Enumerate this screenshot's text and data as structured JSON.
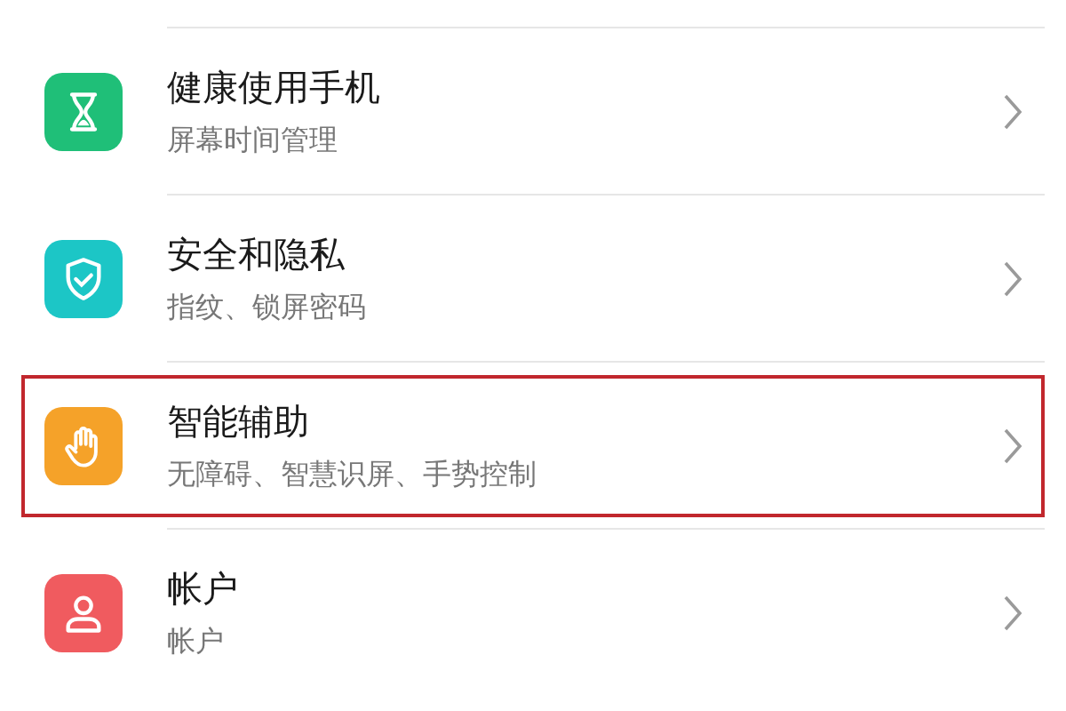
{
  "settings": [
    {
      "kind": "hourglass",
      "color": "#1fbf78",
      "title": "健康使用手机",
      "subtitle": "屏幕时间管理",
      "highlighted": false
    },
    {
      "kind": "shield",
      "color": "#1cc6c6",
      "title": "安全和隐私",
      "subtitle": "指纹、锁屏密码",
      "highlighted": false
    },
    {
      "kind": "hand",
      "color": "#f5a229",
      "title": "智能辅助",
      "subtitle": "无障碍、智慧识屏、手势控制",
      "highlighted": true
    },
    {
      "kind": "person",
      "color": "#f05b5f",
      "title": "帐户",
      "subtitle": "帐户",
      "highlighted": false
    }
  ]
}
